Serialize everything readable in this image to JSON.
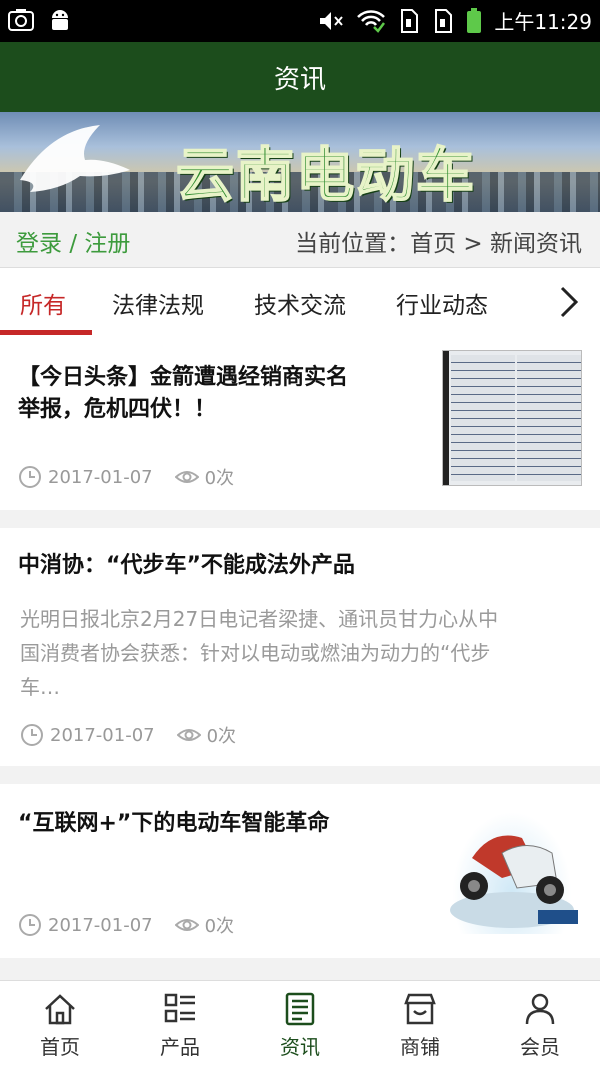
{
  "status_bar": {
    "time": "上午11:29"
  },
  "header": {
    "title": "资讯"
  },
  "banner": {
    "logo_text": "云南电动车"
  },
  "auth": {
    "login": "登录",
    "separator": "/",
    "register": "注册"
  },
  "breadcrumb": {
    "prefix": "当前位置：",
    "home": "首页",
    "arrow": ">",
    "current": "新闻资讯"
  },
  "tabs": [
    {
      "label": "所有",
      "active": true
    },
    {
      "label": "法律法规"
    },
    {
      "label": "技术交流"
    },
    {
      "label": "行业动态"
    }
  ],
  "articles": [
    {
      "title_line1": "【今日头条】金箭遭遇经销商实名",
      "title_line2": "举报，危机四伏！！",
      "date": "2017-01-07",
      "views": "0次"
    },
    {
      "title": "中消协：“代步车”不能成法外产品",
      "summary_line1": "光明日报北京2月27日电记者梁捷、通讯员甘力心从中",
      "summary_line2": "国消费者协会获悉：针对以电动或燃油为动力的“代步",
      "summary_line3": "车…",
      "date": "2017-01-07",
      "views": "0次"
    },
    {
      "title": "“互联网+”下的电动车智能革命",
      "date": "2017-01-07",
      "views": "0次"
    }
  ],
  "bottom_nav": [
    {
      "label": "首页",
      "icon": "home-icon"
    },
    {
      "label": "产品",
      "icon": "grid-list-icon"
    },
    {
      "label": "资讯",
      "icon": "news-icon",
      "active": true
    },
    {
      "label": "商铺",
      "icon": "store-icon"
    },
    {
      "label": "会员",
      "icon": "user-icon"
    }
  ],
  "colors": {
    "header_bg": "#1c4d1c",
    "accent_red": "#c62828",
    "login_green": "#3d9b3d"
  }
}
